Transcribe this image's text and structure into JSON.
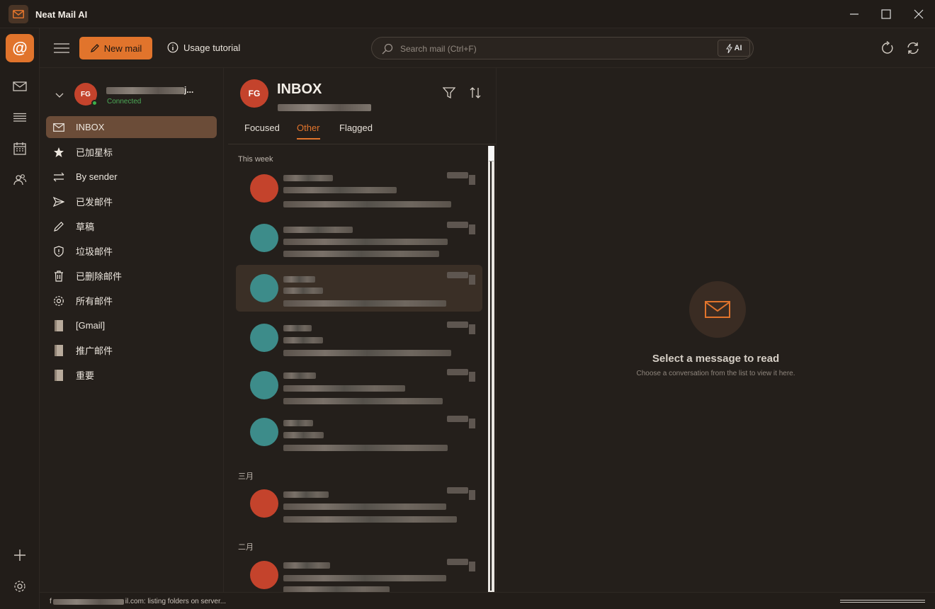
{
  "window": {
    "title": "Neat Mail AI"
  },
  "toolbar": {
    "new_mail_label": "New mail",
    "tutorial_label": "Usage tutorial",
    "search_placeholder": "Search mail (Ctrl+F)",
    "ai_label": "AI"
  },
  "account": {
    "initials": "FG",
    "name_suffix": "j...",
    "status": "Connected"
  },
  "folders": [
    {
      "label": "INBOX",
      "icon": "mail-icon",
      "active": true
    },
    {
      "label": "已加星标",
      "icon": "star-icon"
    },
    {
      "label": "By sender",
      "icon": "swap-icon"
    },
    {
      "label": "已发邮件",
      "icon": "send-icon"
    },
    {
      "label": "草稿",
      "icon": "pencil-icon"
    },
    {
      "label": "垃圾邮件",
      "icon": "shield-icon"
    },
    {
      "label": "已删除邮件",
      "icon": "trash-icon"
    },
    {
      "label": "所有邮件",
      "icon": "gear-icon"
    },
    {
      "label": "[Gmail]",
      "icon": "folder-icon"
    },
    {
      "label": "推广邮件",
      "icon": "folder-icon"
    },
    {
      "label": "重要",
      "icon": "folder-icon"
    }
  ],
  "list": {
    "avatar_initials": "FG",
    "title": "INBOX",
    "tabs": [
      {
        "label": "Focused"
      },
      {
        "label": "Other",
        "active": true
      },
      {
        "label": "Flagged"
      }
    ],
    "groups": {
      "this_week": "This week",
      "march": "三月",
      "february": "二月"
    }
  },
  "reader": {
    "empty_title": "Select a message to read",
    "empty_subtitle": "Choose a conversation from the list to view it here."
  },
  "status": {
    "prefix": "f",
    "suffix": "il.com: listing folders on server..."
  },
  "colors": {
    "accent": "#e1742c",
    "avatar_red": "#c4432c",
    "avatar_teal": "#3d8c8a",
    "connected": "#4caa57"
  }
}
